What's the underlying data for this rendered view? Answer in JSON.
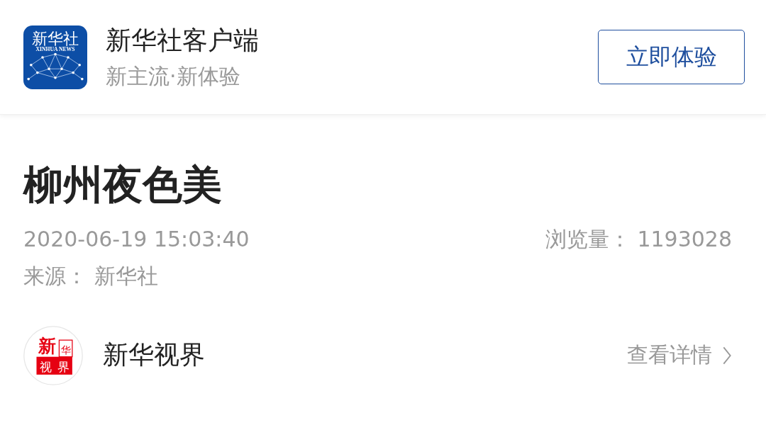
{
  "banner": {
    "logo": {
      "text": "新华社",
      "subtext": "XINHUA NEWS"
    },
    "app_name": "新华社客户端",
    "slogan": "新主流·新体验",
    "button": "立即体验"
  },
  "article": {
    "title": "柳州夜色美",
    "date": "2020-06-19 15:03:40",
    "views_label": "浏览量：",
    "views": "1193028",
    "source_label": "来源：",
    "source": "新华社"
  },
  "account": {
    "avatar": {
      "top": [
        "新",
        "华"
      ],
      "bottom": [
        "视",
        "界"
      ]
    },
    "name": "新华视界",
    "link": "查看详情"
  }
}
